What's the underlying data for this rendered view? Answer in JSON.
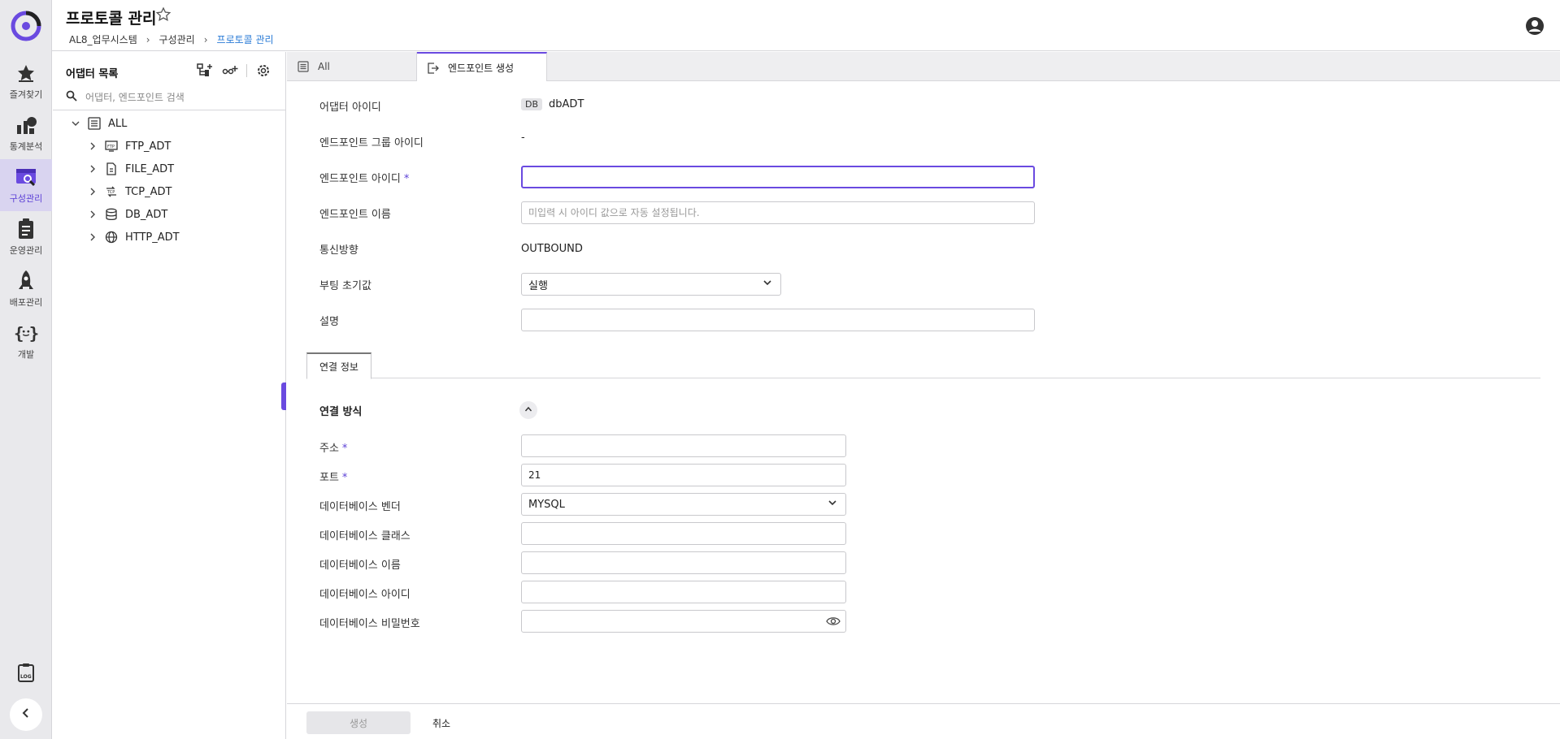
{
  "nav": {
    "items": [
      {
        "label": "즐겨찾기",
        "icon": "star-icon"
      },
      {
        "label": "통계분석",
        "icon": "chart-icon"
      },
      {
        "label": "구성관리",
        "icon": "config-icon",
        "active": true
      },
      {
        "label": "운영관리",
        "icon": "clipboard-icon"
      },
      {
        "label": "배포관리",
        "icon": "rocket-icon"
      },
      {
        "label": "개발",
        "icon": "code-braces-icon"
      }
    ],
    "log_icon": "log-icon",
    "collapse_icon": "chevron-left-icon"
  },
  "header": {
    "title": "프로토콜 관리",
    "breadcrumb": [
      "AL8_업무시스템",
      "구성관리",
      "프로토콜 관리"
    ]
  },
  "adapter_panel": {
    "title": "어댑터 목록",
    "search_placeholder": "어댑터, 엔드포인트 검색",
    "tree": [
      {
        "label": "ALL",
        "expanded": true,
        "level": 0
      },
      {
        "label": "FTP_ADT",
        "level": 1
      },
      {
        "label": "FILE_ADT",
        "level": 1
      },
      {
        "label": "TCP_ADT",
        "level": 1
      },
      {
        "label": "DB_ADT",
        "level": 1
      },
      {
        "label": "HTTP_ADT",
        "level": 1
      }
    ]
  },
  "tabs": [
    {
      "label": "All"
    },
    {
      "label": "엔드포인트 생성",
      "active": true
    }
  ],
  "form": {
    "adapter_id_label": "어댑터 아이디",
    "adapter_id_badge": "DB",
    "adapter_id_value": "dbADT",
    "group_id_label": "엔드포인트 그룹 아이디",
    "group_id_value": "-",
    "endpoint_id_label": "엔드포인트 아이디",
    "endpoint_id_value": "",
    "endpoint_name_label": "엔드포인트 이름",
    "endpoint_name_placeholder": "미입력 시 아이디 값으로 자동 설정됩니다.",
    "direction_label": "통신방향",
    "direction_value": "OUTBOUND",
    "boot_label": "부팅 초기값",
    "boot_value": "실행",
    "desc_label": "설명",
    "desc_value": "",
    "required_mark": "*"
  },
  "subtab": {
    "label": "연결 정보"
  },
  "connection": {
    "section_title": "연결 방식",
    "address_label": "주소",
    "address_value": "",
    "port_label": "포트",
    "port_value": "21",
    "vendor_label": "데이터베이스 벤더",
    "vendor_value": "MYSQL",
    "class_label": "데이터베이스 클래스",
    "class_value": "",
    "dbname_label": "데이터베이스 이름",
    "dbname_value": "",
    "dbid_label": "데이터베이스 아이디",
    "dbid_value": "",
    "dbpw_label": "데이터베이스 비밀번호",
    "dbpw_value": ""
  },
  "footer": {
    "create_label": "생성",
    "cancel_label": "취소"
  },
  "colors": {
    "accent": "#6a4ae0",
    "link": "#2a7bd6"
  }
}
